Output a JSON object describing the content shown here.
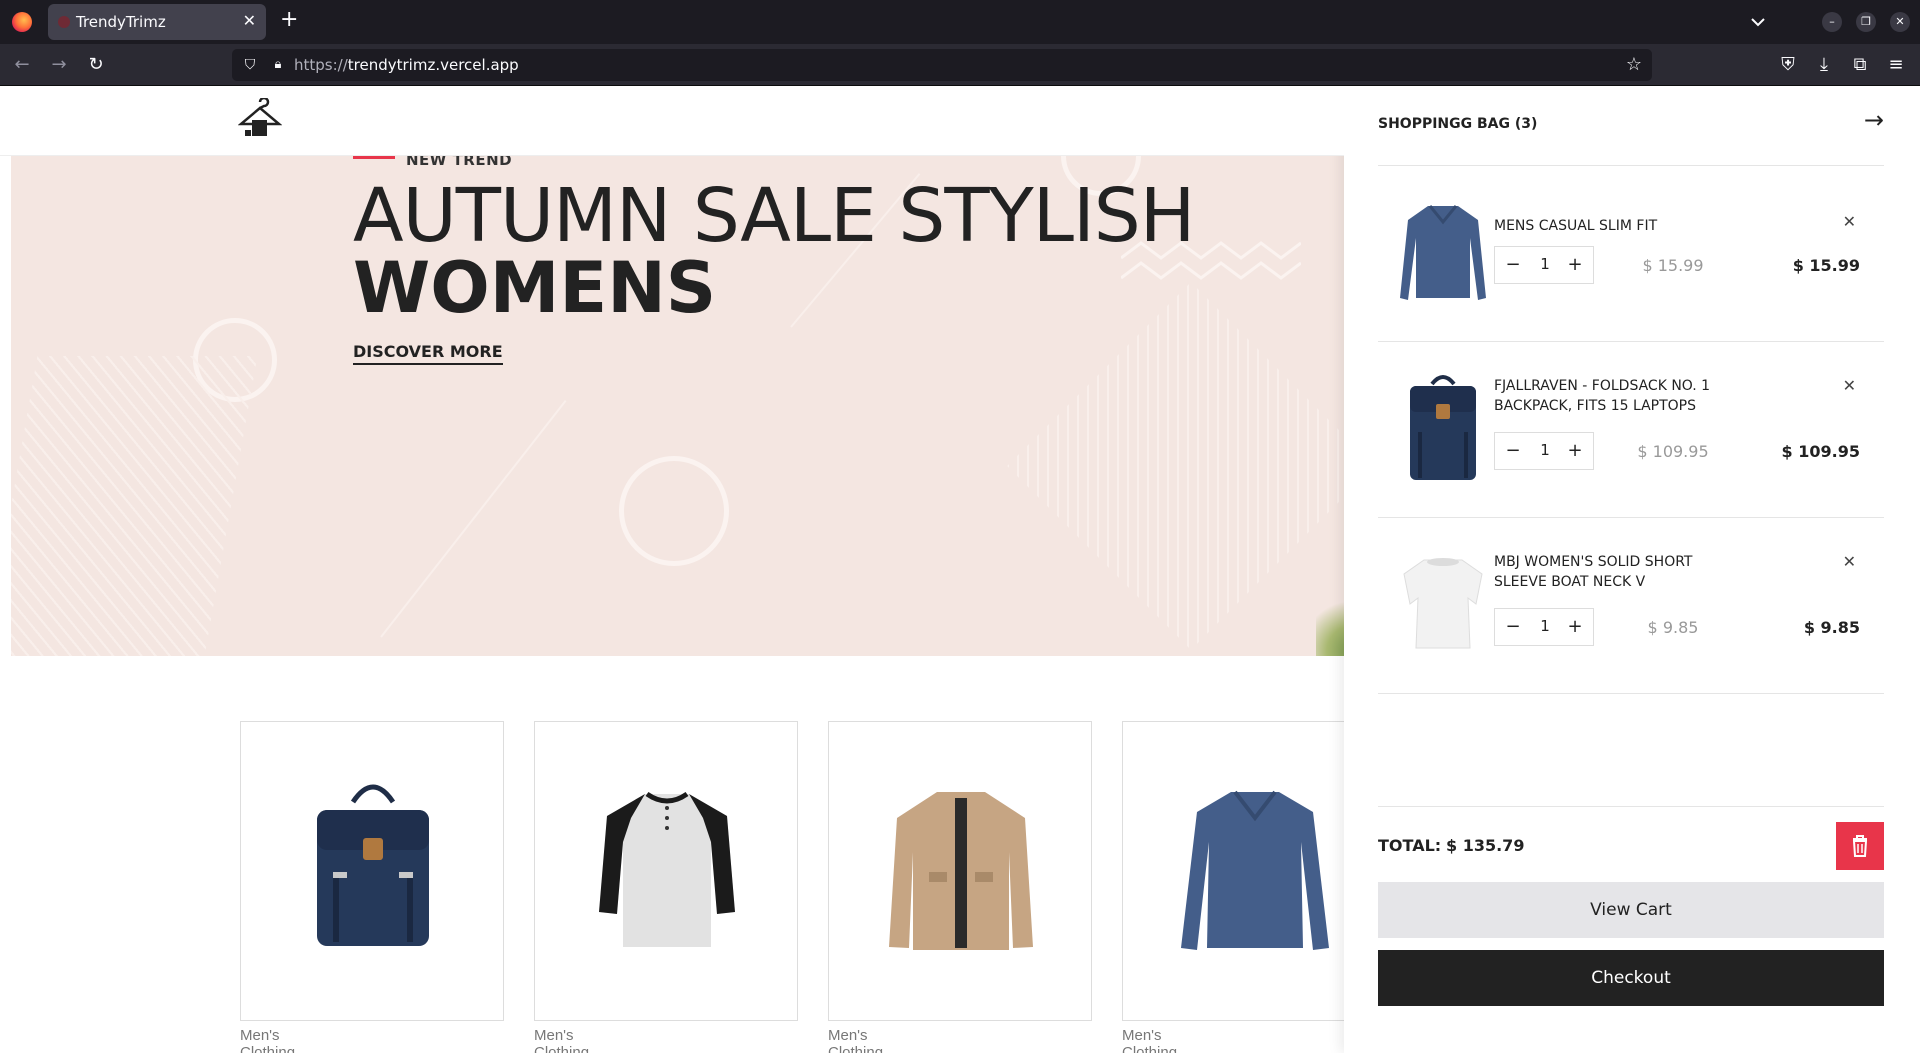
{
  "browser": {
    "tab_title": "TrendyTrimz",
    "url_protocol": "https://",
    "url_host": "trendytrimz.vercel.app"
  },
  "hero": {
    "tag": "NEW TREND",
    "title_line1": "AUTUMN SALE STYLISH",
    "title_line2": "WOMENS",
    "cta": "DISCOVER MORE"
  },
  "products": [
    {
      "category": "Men's Clothing",
      "image": "backpack"
    },
    {
      "category": "Men's Clothing",
      "image": "henley-tshirt"
    },
    {
      "category": "Men's Clothing",
      "image": "cotton-jacket"
    },
    {
      "category": "Men's Clothing",
      "image": "longsleeve-tshirt"
    }
  ],
  "cart": {
    "title": "SHOPPINGG BAG (3)",
    "items": [
      {
        "name_line1": "MENS CASUAL SLIM FIT",
        "name_line2": "",
        "qty": "1",
        "price": "$ 15.99",
        "total": "$ 15.99",
        "image": "longsleeve-tshirt"
      },
      {
        "name_line1": "FJALLRAVEN - FOLDSACK NO. 1",
        "name_line2": "BACKPACK, FITS 15 LAPTOPS",
        "qty": "1",
        "price": "$ 109.95",
        "total": "$ 109.95",
        "image": "backpack"
      },
      {
        "name_line1": "MBJ WOMEN'S SOLID SHORT",
        "name_line2": "SLEEVE BOAT NECK V",
        "qty": "1",
        "price": "$ 9.85",
        "total": "$ 9.85",
        "image": "white-top"
      }
    ],
    "total_label": "TOTAL:",
    "total_value": "$ 135.79",
    "view_cart": "View Cart",
    "checkout": "Checkout"
  },
  "colors": {
    "accent": "#e8354a",
    "hero_bg": "#f4e6e1",
    "dark": "#222222"
  }
}
